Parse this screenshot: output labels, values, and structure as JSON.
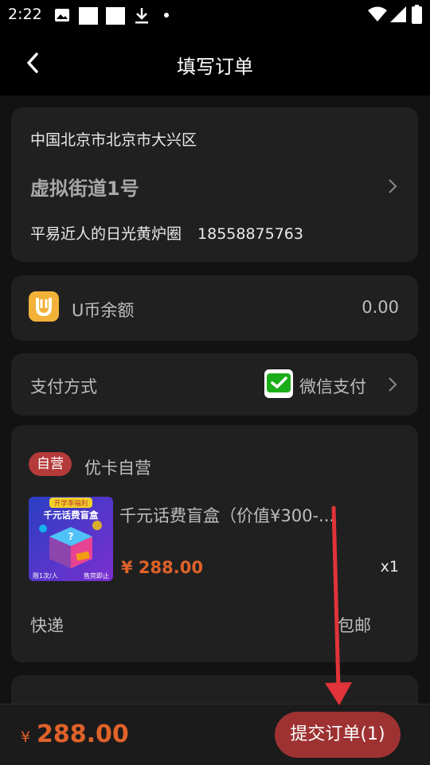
{
  "status_bar": {
    "time": "2:22"
  },
  "nav": {
    "title": "填写订单"
  },
  "address": {
    "region": "中国北京市北京市大兴区",
    "street": "虚拟街道1号",
    "name": "平易近人的日光黄炉圈",
    "phone": "18558875763"
  },
  "ucoin": {
    "label": "U币余额",
    "value": "0.00"
  },
  "payment": {
    "label": "支付方式",
    "method": "微信支付"
  },
  "store": {
    "badge": "自营",
    "name": "优卡自营",
    "product": {
      "title": "千元话费盲盒（价值¥300-...",
      "price": "¥ 288.00",
      "qty": "x1",
      "image_text_top": "开学季福利",
      "image_text_main": "千元话费盲盒",
      "image_text_left": "限1次/人",
      "image_text_right": "售完即止"
    },
    "shipping_label": "快递",
    "shipping_value": "包邮"
  },
  "footer": {
    "currency": "¥",
    "total": "288.00",
    "submit_label": "提交订单(1)"
  },
  "colors": {
    "accent": "#e0622a",
    "button": "#9e3232",
    "badge": "#b53a3a",
    "annotation_arrow": "#e0333a"
  }
}
